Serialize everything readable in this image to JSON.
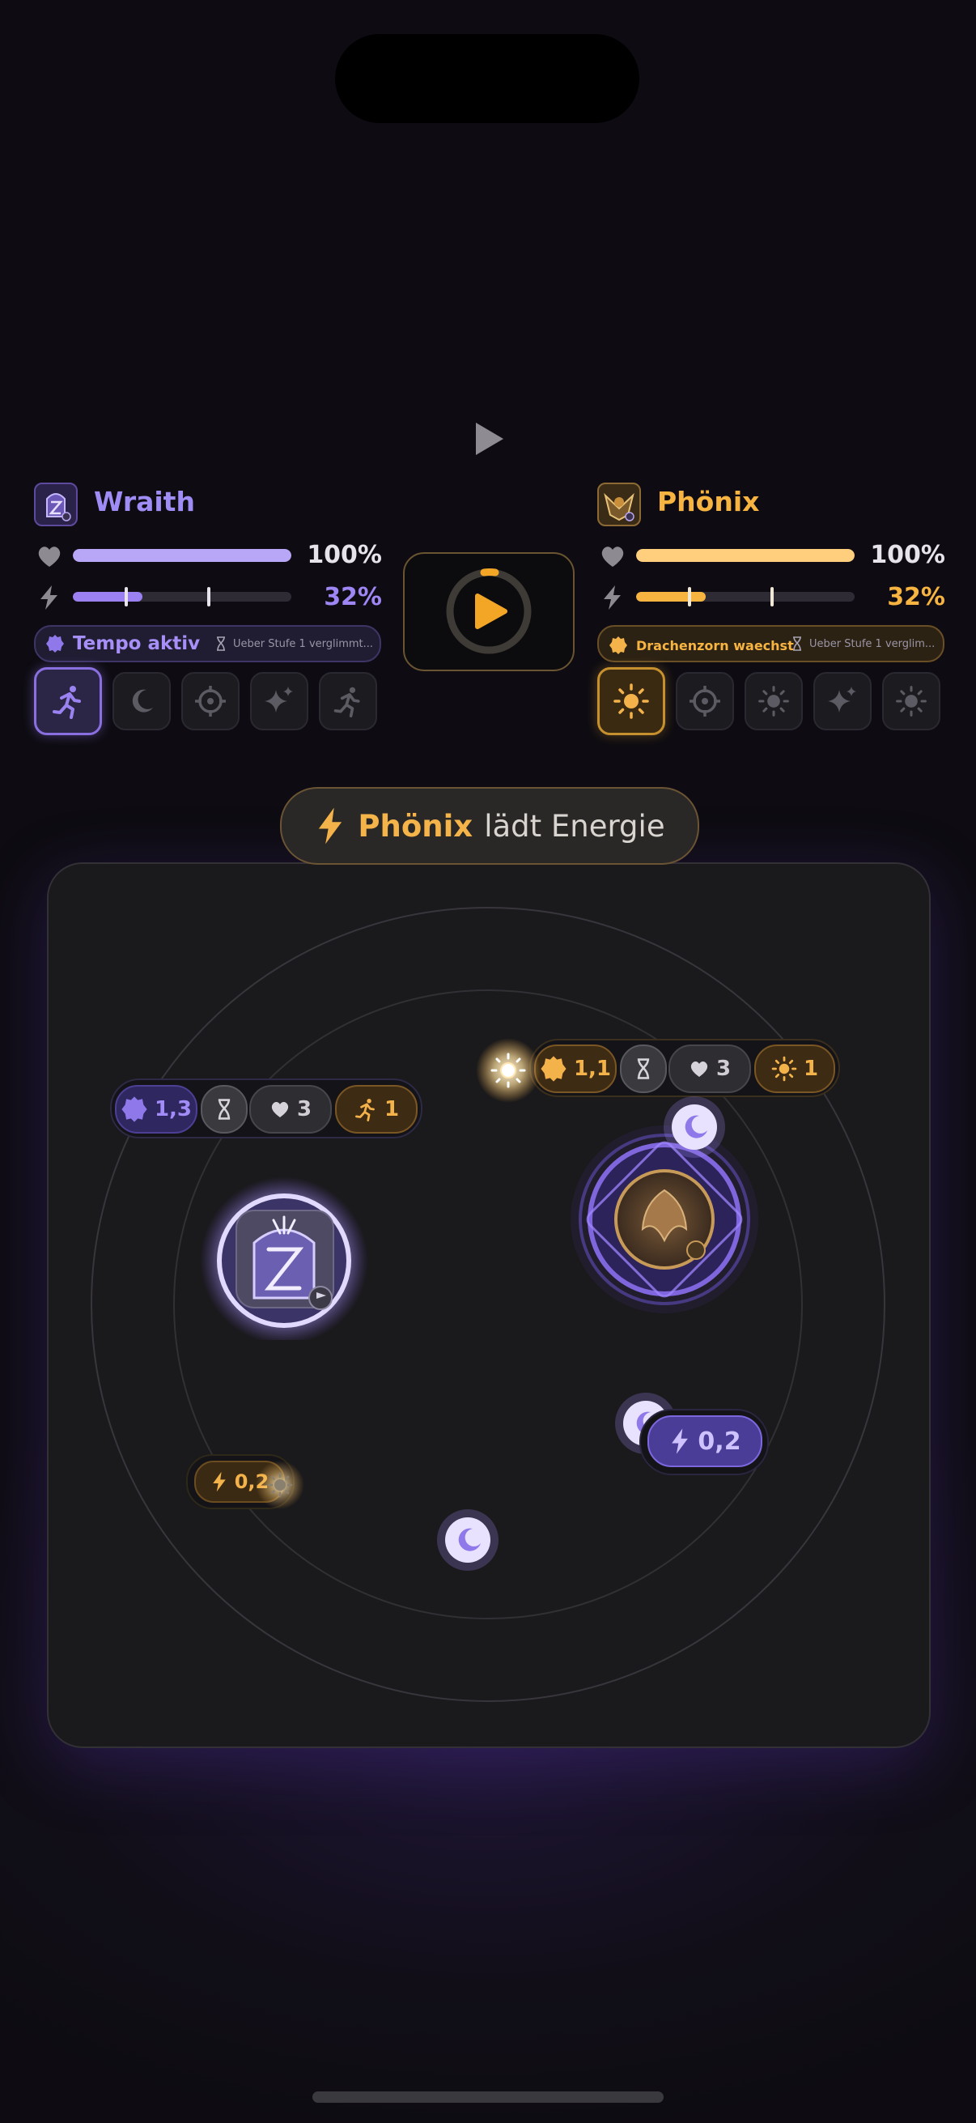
{
  "wraith": {
    "name": "Wraith",
    "hp_label": "100%",
    "hp_fraction": 1.0,
    "energy_label": "32%",
    "energy_fraction": 0.32,
    "status": "Tempo aktiv",
    "status_sub": "Ueber Stufe 1 verglimmt...",
    "skills": [
      "runner-icon",
      "moon-icon",
      "crosshair-icon",
      "sparkle-icon",
      "runner-icon"
    ],
    "color": "#a08cf5"
  },
  "phoenix": {
    "name": "Phönix",
    "hp_label": "100%",
    "hp_fraction": 1.0,
    "energy_label": "32%",
    "energy_fraction": 0.32,
    "status": "Drachenzorn waechst",
    "status_sub": "Ueber Stufe 1 verglim...",
    "skills": [
      "sun-icon",
      "crosshair-icon",
      "sun-icon",
      "sparkle-icon",
      "sun-icon"
    ],
    "color": "#f7b441"
  },
  "banner": {
    "who": "Phönix",
    "what": "lädt Energie"
  },
  "board": {
    "wraith_chips": {
      "attack": "1,3",
      "hp": "3",
      "move": "1"
    },
    "phoenix_chips": {
      "attack": "1,1",
      "hp": "3",
      "power": "1"
    },
    "phoenix_energy": "0,2",
    "wraith_energy": "0,2"
  },
  "accents": {
    "violet": "#8f78ea",
    "amber": "#f4b24a"
  }
}
